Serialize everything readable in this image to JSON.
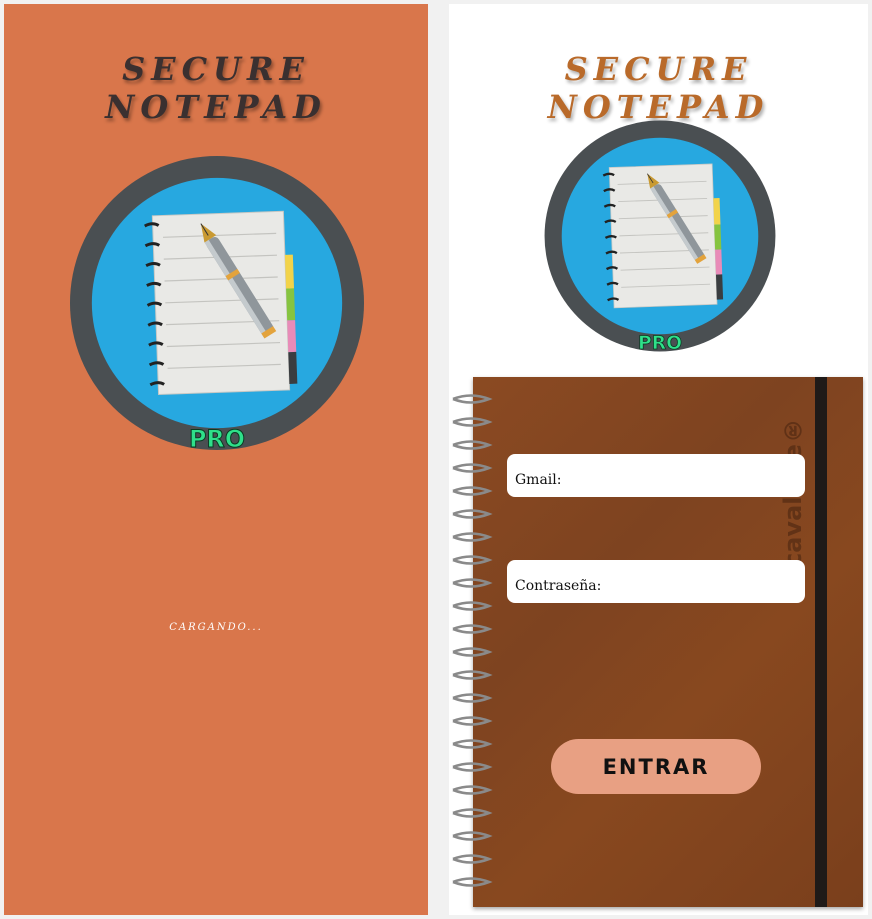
{
  "splash": {
    "title": "SECURE NOTEPAD",
    "logo_badge": "PRO",
    "loading_text": "CARGANDO...",
    "background": "#d9764b"
  },
  "login": {
    "title": "SECURE NOTEPAD",
    "logo_badge": "PRO",
    "notebook_brand": "cavallote®",
    "gmail_label": "Gmail:",
    "gmail_value": "",
    "password_label": "Contraseña:",
    "password_value": "",
    "submit_label": "ENTRAR",
    "colors": {
      "title": "#b96a2a",
      "button": "#e8a083",
      "notebook_cover": "#8b4a22"
    }
  },
  "icons": {
    "logo": "notepad-with-pen-icon",
    "spiral": "spiral-binding-icon"
  }
}
